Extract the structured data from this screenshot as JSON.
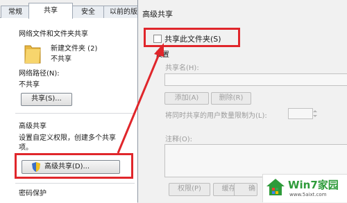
{
  "tabs": [
    "常规",
    "共享",
    "安全",
    "以前的版"
  ],
  "left": {
    "section1_title": "网络文件和文件夹共享",
    "folder_name": "新建文件夹 (2)",
    "folder_status": "不共享",
    "network_path_label": "网络路径(N):",
    "network_path_value": "不共享",
    "share_button": "共享(S)...",
    "advanced_title": "高级共享",
    "advanced_desc_line1": "设置自定义权限，创建多个共享",
    "advanced_desc_line2": "项。",
    "advanced_button": "高级共享(D)...",
    "password_title": "密码保护"
  },
  "dialog": {
    "title": "高级共享",
    "share_checkbox_label": "共享此文件夹(S)",
    "settings_label": "设置",
    "share_name_label": "共享名(H):",
    "add_button": "添加(A)",
    "remove_button": "删除(R)",
    "limit_label": "将同时共享的用户数量限制为(L):",
    "comment_label": "注释(O):",
    "permissions_button": "权限(P)",
    "cache_button": "缓存(C)",
    "ok_button_partial": "确"
  },
  "watermark": {
    "brand": "Win7家园",
    "url": "www.5aixt.com"
  },
  "colors": {
    "highlight_red": "#e0262b",
    "arrow_red": "#e0262b",
    "brand_green": "#2e9b3a"
  }
}
